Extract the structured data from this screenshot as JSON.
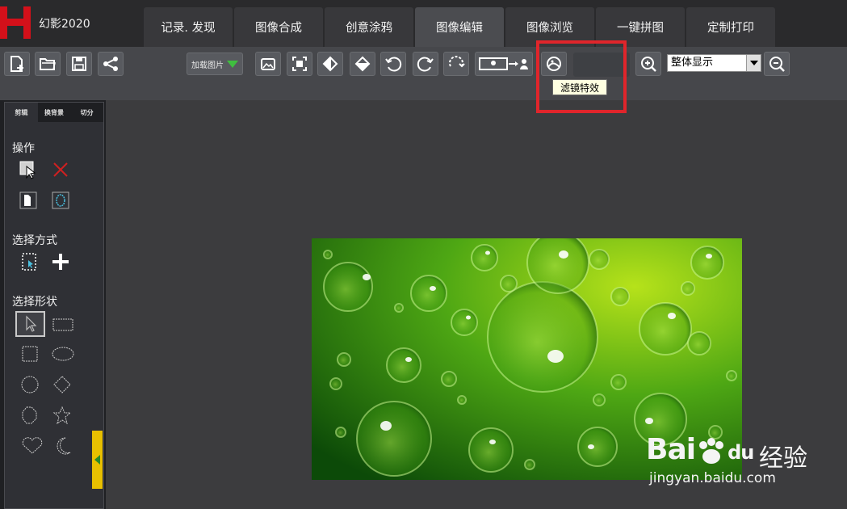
{
  "app": {
    "title": "幻影2020"
  },
  "tabs": [
    {
      "label": "记录. 发现"
    },
    {
      "label": "图像合成"
    },
    {
      "label": "创意涂鸦"
    },
    {
      "label": "图像编辑",
      "active": true
    },
    {
      "label": "图像浏览"
    },
    {
      "label": "一键拼图"
    },
    {
      "label": "定制打印"
    }
  ],
  "toolbar": {
    "load_label": "加载图片",
    "zoom_value": "整体显示",
    "tooltip": "滤镜特效"
  },
  "left_panel": {
    "tabs": [
      "剪辑",
      "换背景",
      "切分"
    ],
    "section_operation": "操作",
    "section_select_mode": "选择方式",
    "section_select_shape": "选择形状"
  },
  "watermark": {
    "brand": "Bai",
    "brand_suffix": "du",
    "cn": "经验",
    "url": "jingyan.baidu.com"
  },
  "colors": {
    "accent_red": "#e0252b",
    "logo_red": "#d4101a",
    "handle_yellow": "#e8c000",
    "toolbar_bg": "#46474b"
  }
}
